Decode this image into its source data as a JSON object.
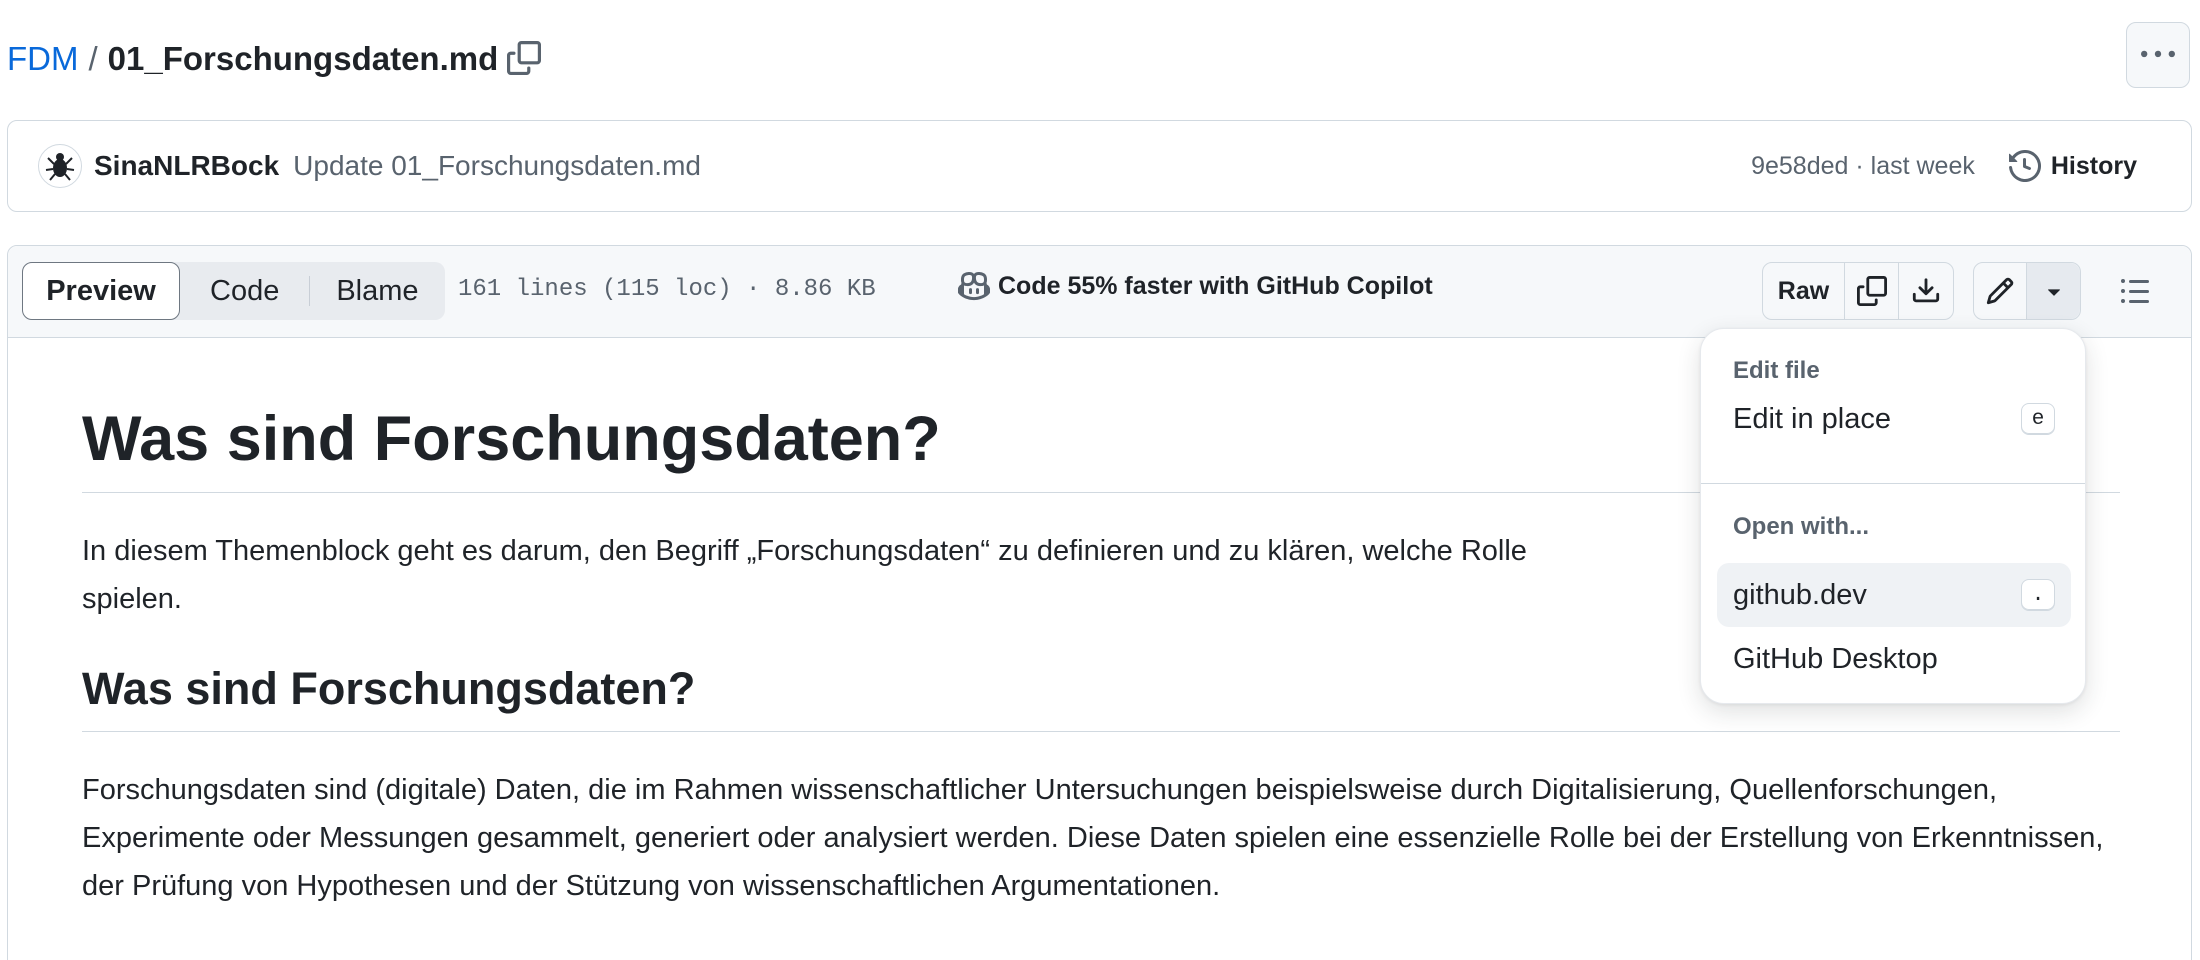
{
  "breadcrumb": {
    "repo": "FDM",
    "separator": "/",
    "file": "01_Forschungsdaten.md"
  },
  "commit": {
    "author": "SinaNLRBock",
    "message": "Update 01_Forschungsdaten.md",
    "meta": "9e58ded · last week",
    "history_label": "History"
  },
  "file_header": {
    "tabs": [
      {
        "label": "Preview",
        "selected": true
      },
      {
        "label": "Code",
        "selected": false
      },
      {
        "label": "Blame",
        "selected": false
      }
    ],
    "stats": "161 lines (115 loc) · 8.86 KB",
    "copilot": "Code 55% faster with GitHub Copilot",
    "raw_label": "Raw"
  },
  "content": {
    "h1": "Was sind Forschungsdaten?",
    "p1": "In diesem Themenblock geht es darum, den Begriff „Forschungsdaten“ zu definieren und zu klären, welche Rolle",
    "p1_tail": "s",
    "p1_line2": "spielen.",
    "h2": "Was sind Forschungsdaten?",
    "p2": "Forschungsdaten sind (digitale) Daten, die im Rahmen wissenschaftlicher Untersuchungen beispielsweise durch Digitalisierung, Quellenforschungen, Experimente oder Messungen gesammelt, generiert oder analysiert werden. Diese Daten spielen eine essenzielle Rolle bei der Erstellung von Erkenntnissen, der Prüfung von Hypothesen und der Stützung von wissenschaftlichen Argumentationen."
  },
  "dropdown": {
    "edit_heading": "Edit file",
    "edit_in_place": "Edit in place",
    "edit_in_place_key": "e",
    "open_heading": "Open with...",
    "github_dev": "github.dev",
    "github_dev_key": ".",
    "github_desktop": "GitHub Desktop"
  },
  "colors": {
    "link": "#0969da",
    "muted": "#59636e",
    "border": "#d1d9e0"
  }
}
